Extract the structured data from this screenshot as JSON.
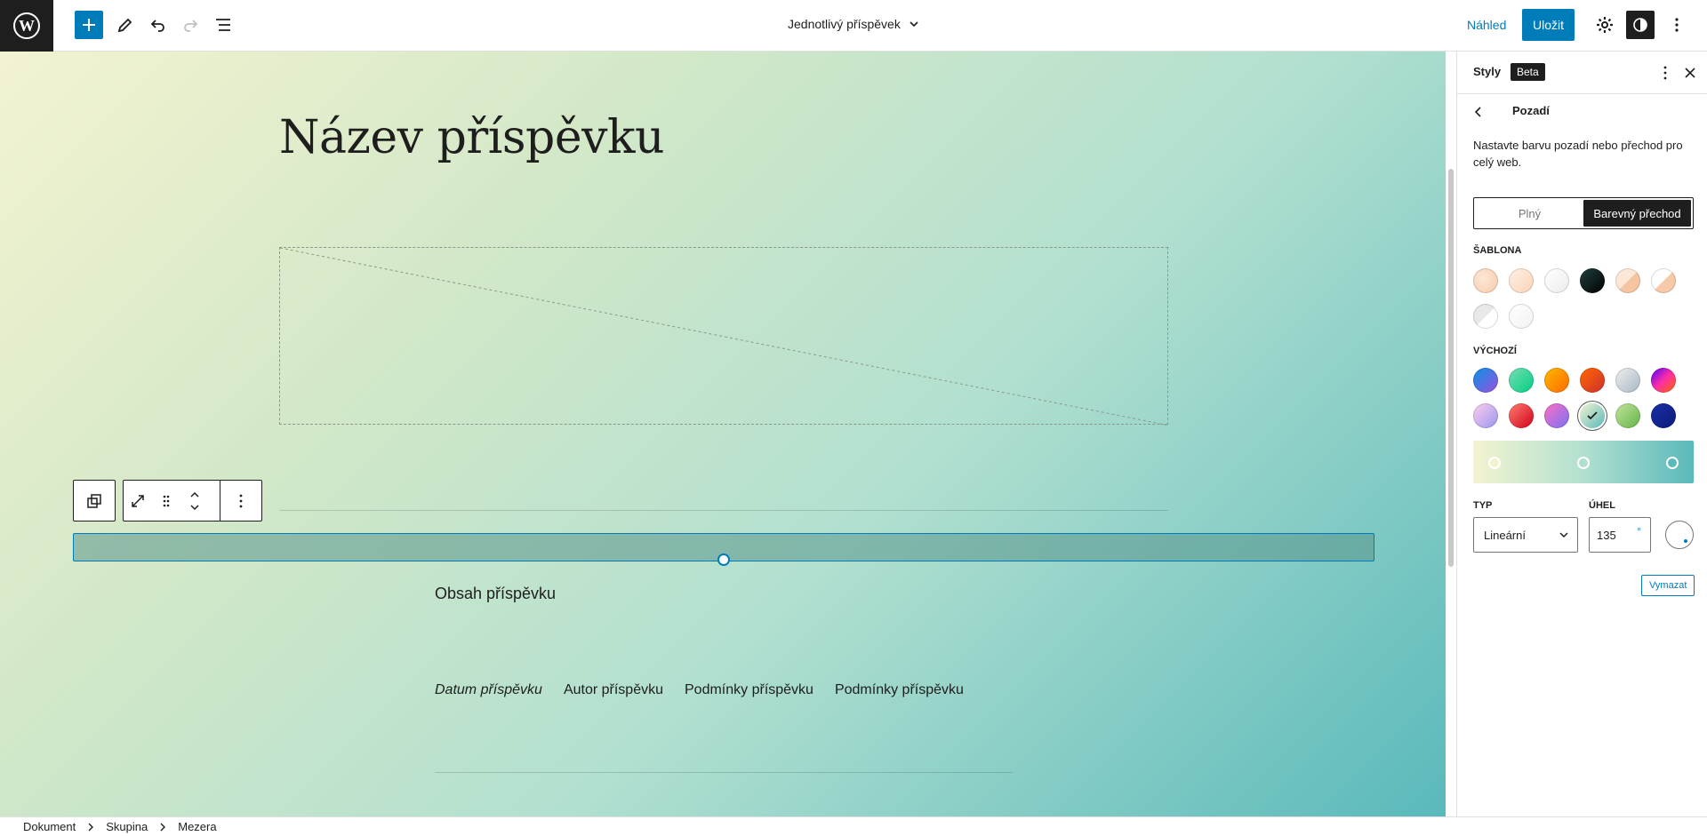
{
  "topbar": {
    "document_title": "Jednotlivý příspěvek",
    "preview_label": "Náhled",
    "save_label": "Uložit"
  },
  "canvas": {
    "post_title": "Název příspěvku",
    "post_content": "Obsah příspěvku",
    "meta": {
      "date": "Datum příspěvku",
      "author": "Autor příspěvku",
      "terms_1": "Podmínky příspěvku",
      "terms_2": "Podmínky příspěvku"
    }
  },
  "sidebar": {
    "title": "Styly",
    "badge": "Beta",
    "panel_title": "Pozadí",
    "description": "Nastavte barvu pozadí nebo přechod pro celý web.",
    "tabs": {
      "solid": "Plný",
      "gradient": "Barevný přechod"
    },
    "section_template": "Šablona",
    "section_default": "Výchozí",
    "type_label": "Typ",
    "type_value": "Lineární",
    "angle_label": "Úhel",
    "angle_value": "135",
    "angle_unit": "°",
    "clear_label": "Vymazat",
    "template_swatches": [
      "radial-gradient(circle at 40% 40%, #fde8d8, #f6c9a8)",
      "linear-gradient(135deg, #fff0e4, #f8d4b8)",
      "linear-gradient(135deg, #ffffff, #ececec)",
      "linear-gradient(135deg, #204040, #000000)",
      "linear-gradient(135deg, #fde8d8 50%, #f4c5a0 50%)",
      "linear-gradient(135deg, #ffffff 50%, #f6c9a8 50%)",
      "linear-gradient(135deg, #e8e8e8 50%, #ffffff 50%)",
      "linear-gradient(135deg, #ffffff, #f2f2f2)"
    ],
    "default_swatches": [
      "linear-gradient(135deg, #0693e3, #9b51e0)",
      "linear-gradient(135deg, #7adcb4, #00d082)",
      "linear-gradient(135deg, #fcb900, #ff6900)",
      "linear-gradient(135deg, #ff6900, #cf2e2e)",
      "linear-gradient(135deg, #eeeeee, #a9b8c3)",
      "linear-gradient(135deg, #4d00ff, #ff2ea6, #ff6900)",
      "linear-gradient(135deg, #ffceec, #9896f0)",
      "linear-gradient(135deg, #fe7e6e, #d2001a)",
      "linear-gradient(135deg, #ff6ec4, #7873f5)",
      "linear-gradient(135deg, #f3f3d0, #5ab9bb)",
      "linear-gradient(135deg, #c2e59c, #64b349)",
      "linear-gradient(135deg, #1a2fa8, #0b1a78)"
    ],
    "selected_default_index": 9,
    "gradient_stops": [
      {
        "color": "#f3f3d0",
        "position": 0
      },
      {
        "color": "#b2e0d0",
        "position": 50
      },
      {
        "color": "#5ab9bb",
        "position": 100
      }
    ]
  },
  "breadcrumb": [
    "Dokument",
    "Skupina",
    "Mezera"
  ],
  "colors": {
    "accent": "#007cba",
    "dark": "#1e1e1e",
    "canvas_gradient": "linear-gradient(135deg, #f3f3d0, #5ab9bb)"
  }
}
